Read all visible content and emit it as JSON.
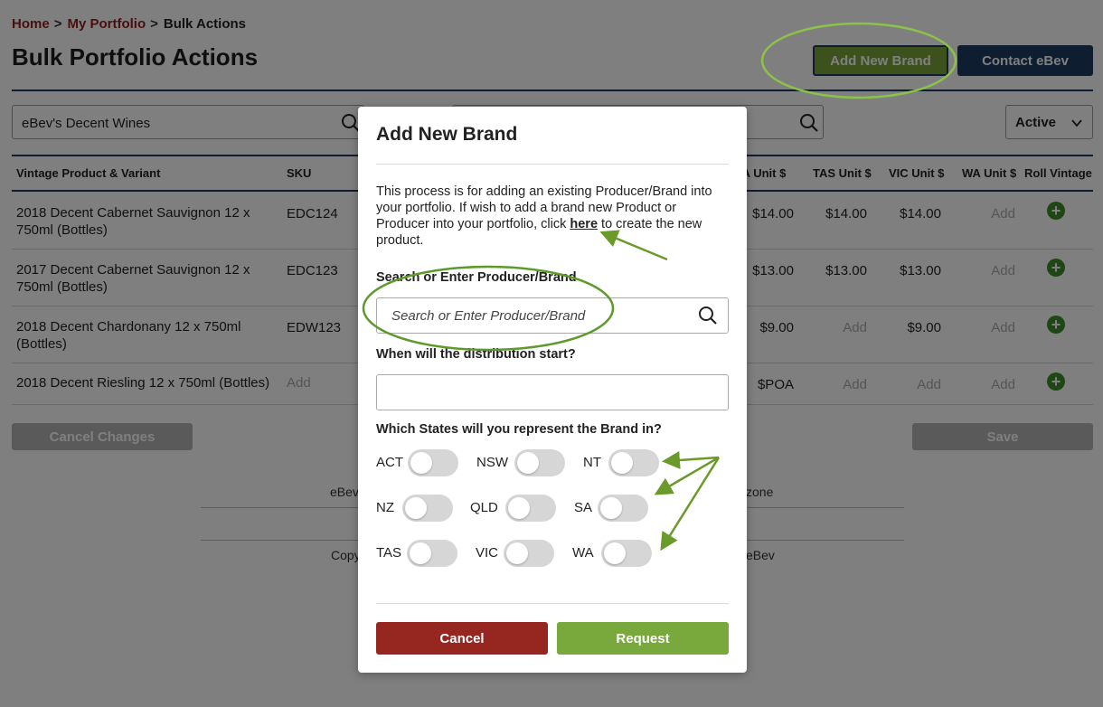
{
  "breadcrumb": {
    "home": "Home",
    "portfolio": "My Portfolio",
    "current": "Bulk Actions",
    "separator": ">"
  },
  "page": {
    "title": "Bulk Portfolio Actions"
  },
  "header_buttons": {
    "add_brand": "Add New Brand",
    "contact": "Contact eBev"
  },
  "filters": {
    "producer_search_value": "eBev's Decent Wines",
    "status_value": "Active"
  },
  "table": {
    "headers": {
      "product": "Vintage Product & Variant",
      "sku": "SKU",
      "sa": "SA Unit $",
      "tas": "TAS Unit $",
      "vic": "VIC Unit $",
      "wa": "WA Unit $",
      "roll": "Roll Vintage"
    },
    "rows": [
      {
        "product_line1": "2018 Decent Cabernet Sauvignon 12 x",
        "product_line2": "750ml (Bottles)",
        "sku": "EDC124",
        "sa": "$14.00",
        "tas": "$14.00",
        "vic": "$14.00",
        "wa": "Add"
      },
      {
        "product_line1": "2017 Decent Cabernet Sauvignon 12 x",
        "product_line2": "750ml (Bottles)",
        "sku": "EDC123",
        "sa": "$13.00",
        "tas": "$13.00",
        "vic": "$13.00",
        "wa": "Add"
      },
      {
        "product_line1": "2018 Decent Chardonany 12 x 750ml",
        "product_line2": "(Bottles)",
        "sku": "EDW123",
        "sa": "$9.00",
        "tas": "Add",
        "vic": "$9.00",
        "wa": "Add"
      },
      {
        "product_line1": "2018 Decent Riesling 12 x 750ml (Bottles)",
        "product_line2": "",
        "sku": "Add",
        "sa": "$POA",
        "tas": "Add",
        "vic": "Add",
        "wa": "Add"
      }
    ]
  },
  "actions": {
    "cancel_changes": "Cancel Changes",
    "save": "Save"
  },
  "footer": {
    "left_top": "eBev",
    "right_top": "zone",
    "left_bottom": "Copy",
    "right_bottom": "eBev"
  },
  "modal": {
    "title": "Add New Brand",
    "intro_before": "This process is for adding an existing Producer/Brand into your portfolio. If wish to add a brand new Product or Producer into your portfolio, click ",
    "intro_link": "here",
    "intro_after": " to create the new product.",
    "search_label": "Search or Enter Producer/Brand",
    "search_placeholder": "Search or Enter Producer/Brand",
    "date_label": "When will the distribution start?",
    "date_value": "",
    "states_label": "Which States will you represent the Brand in?",
    "states": [
      {
        "code": "ACT",
        "on": false
      },
      {
        "code": "NSW",
        "on": false
      },
      {
        "code": "NT",
        "on": false
      },
      {
        "code": "NZ",
        "on": false
      },
      {
        "code": "QLD",
        "on": false
      },
      {
        "code": "SA",
        "on": false
      },
      {
        "code": "TAS",
        "on": false
      },
      {
        "code": "VIC",
        "on": false
      },
      {
        "code": "WA",
        "on": false
      }
    ],
    "cancel": "Cancel",
    "request": "Request"
  },
  "colors": {
    "brand_navy": "#1c3a5e",
    "accent_green": "#7ba33a",
    "cancel_red": "#962620",
    "link_red": "#8e1e1e",
    "annotation_green": "#6a9a2a"
  }
}
